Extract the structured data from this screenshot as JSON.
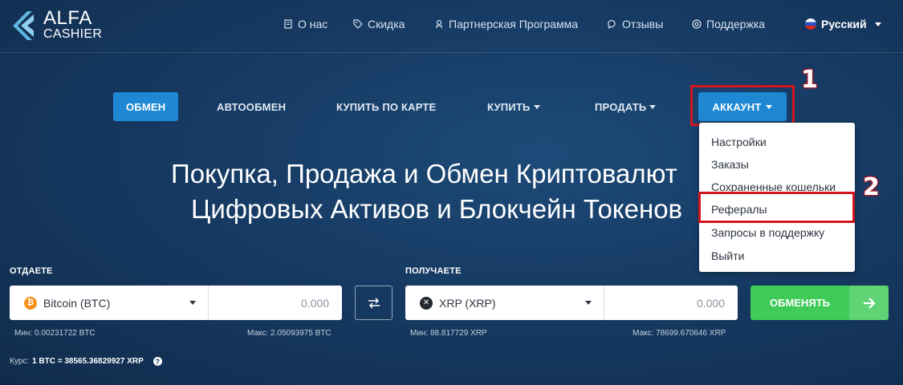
{
  "brand": {
    "line1": "ALFA",
    "line2": "CASHIER"
  },
  "topnav": [
    {
      "label": "О нас",
      "icon": "document-icon"
    },
    {
      "label": "Скидка",
      "icon": "tag-icon"
    },
    {
      "label": "Партнерская Программа",
      "icon": "user-icon"
    },
    {
      "label": "Отзывы",
      "icon": "chat-icon"
    },
    {
      "label": "Поддержка",
      "icon": "lifebuoy-icon"
    }
  ],
  "language": {
    "label": "Русский",
    "icon": "russia-flag-icon"
  },
  "menu": {
    "exchange": "ОБМЕН",
    "autoexchange": "АВТООБМЕН",
    "buy_card": "КУПИТЬ ПО КАРТЕ",
    "buy": "КУПИТЬ",
    "sell": "ПРОДАТЬ",
    "account": "АККАУНТ"
  },
  "annotations": {
    "n1": "1",
    "n2": "2",
    "color": "#d1161e"
  },
  "account_dropdown": [
    "Настройки",
    "Заказы",
    "Сохраненные кошельки",
    "Рефералы",
    "Запросы в поддержку",
    "Выйти"
  ],
  "hero": {
    "line1": "Покупка, Продажа и Обмен Криптовалют",
    "line2": "Цифровых Активов и Блокчейн Токенов"
  },
  "give": {
    "label": "ОТДАЕТЕ",
    "currency": "Bitcoin (BTC)",
    "amount": "0.000",
    "min": "Мин: 0.00231722 BTC",
    "max": "Макс: 2.05093975 BTC",
    "coin_color": "#f7931a"
  },
  "get": {
    "label": "ПОЛУЧАЕТЕ",
    "currency": "XRP (XRP)",
    "amount": "0.000",
    "min": "Мин: 88.817729 XRP",
    "max": "Макс: 78699.670646 XRP",
    "coin_color": "#23292f"
  },
  "submit": {
    "label": "ОБМЕНЯТЬ",
    "color": "#3ecb57"
  },
  "rate": {
    "prefix": "Курс:",
    "value": "1 BTC = 38565.36829927 XRP"
  },
  "colors": {
    "accent": "#1e88d4",
    "background": "#163a63"
  }
}
